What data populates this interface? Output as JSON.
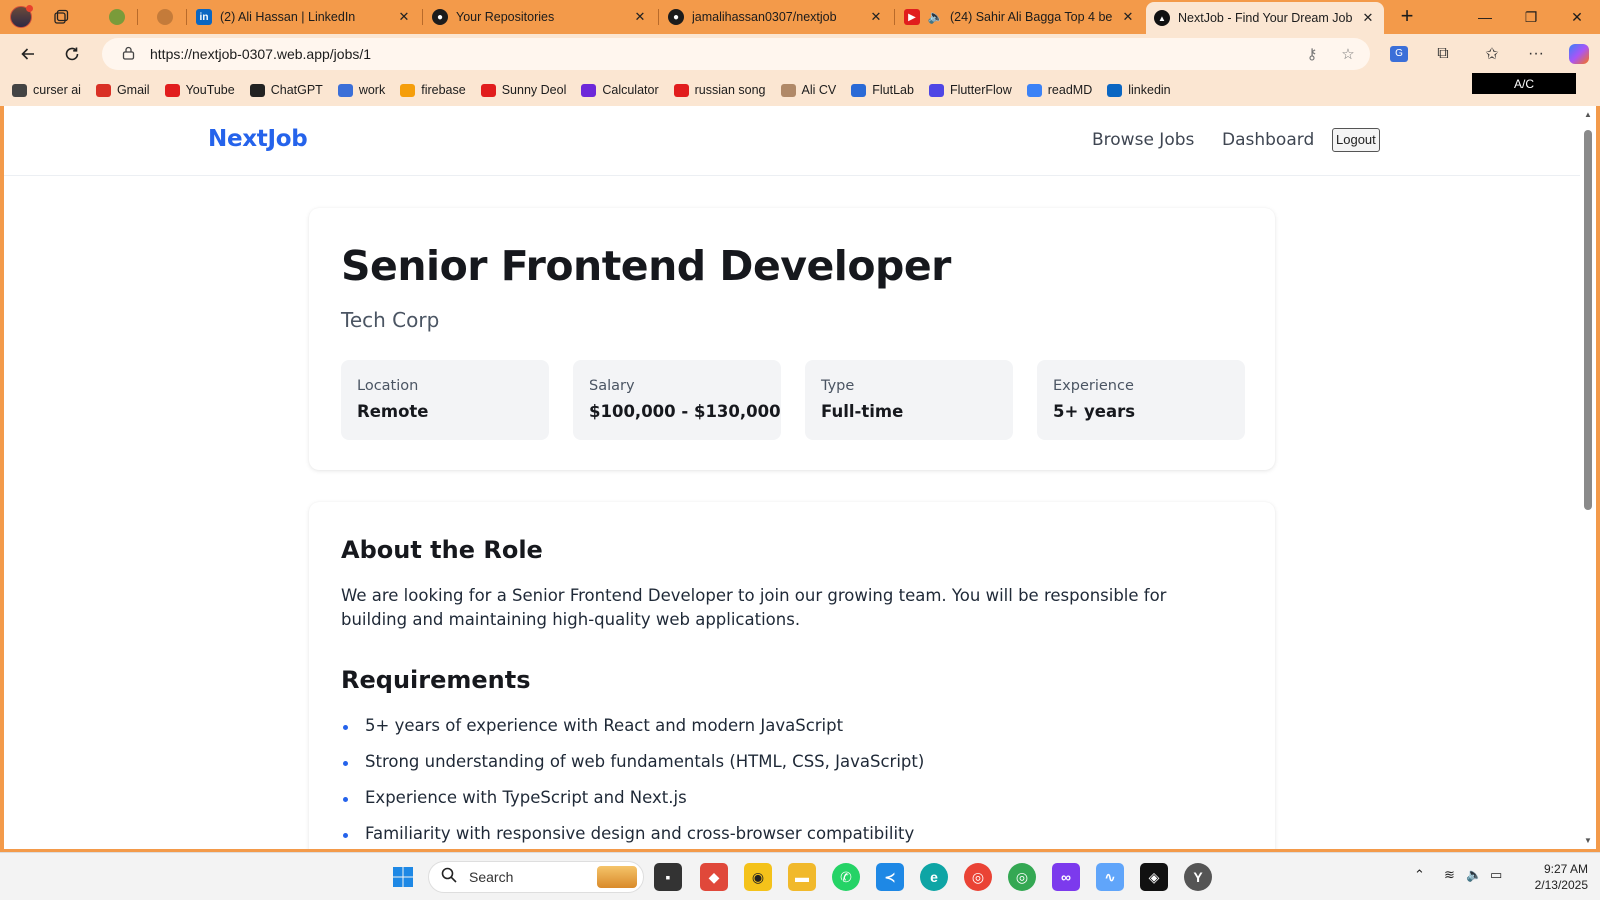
{
  "browser": {
    "tabs": [
      {
        "title": "",
        "favicon": "bundle-icon"
      },
      {
        "title": "",
        "favicon": "green-app-icon"
      },
      {
        "title": "",
        "favicon": "orange-app-icon"
      },
      {
        "title": "(2) Ali Hassan | LinkedIn",
        "favicon": "linkedin-icon"
      },
      {
        "title": "Your Repositories",
        "favicon": "github-icon"
      },
      {
        "title": "jamalihassan0307/nextjob",
        "favicon": "github-icon"
      },
      {
        "title": "(24) Sahir Ali Bagga Top 4 be",
        "favicon": "youtube-icon"
      },
      {
        "title": "NextJob - Find Your Dream Job",
        "favicon": "vercel-icon"
      }
    ],
    "new_tab": "+",
    "url": "https://nextjob-0307.web.app/jobs/1",
    "bookmarks": [
      {
        "label": "curser ai",
        "icon": "cursor-icon",
        "color": "#444444"
      },
      {
        "label": "Gmail",
        "icon": "gmail-icon",
        "color": "#d93025"
      },
      {
        "label": "YouTube",
        "icon": "youtube-icon",
        "color": "#e11d1d"
      },
      {
        "label": "ChatGPT",
        "icon": "chatgpt-icon",
        "color": "#222222"
      },
      {
        "label": "work",
        "icon": "docs-icon",
        "color": "#3b6fd8"
      },
      {
        "label": "firebase",
        "icon": "firebase-icon",
        "color": "#f59e0b"
      },
      {
        "label": "Sunny Deol",
        "icon": "youtube-icon",
        "color": "#e11d1d"
      },
      {
        "label": "Calculator",
        "icon": "calculator-icon",
        "color": "#6d28d9"
      },
      {
        "label": "russian song",
        "icon": "youtube-icon",
        "color": "#e11d1d"
      },
      {
        "label": "Ali CV",
        "icon": "cv-icon",
        "color": "#b08968"
      },
      {
        "label": "FlutLab",
        "icon": "flutlab-icon",
        "color": "#2a6ad6"
      },
      {
        "label": "FlutterFlow",
        "icon": "flutterflow-icon",
        "color": "#4f46e5"
      },
      {
        "label": "readMD",
        "icon": "readmd-icon",
        "color": "#3b82f6"
      },
      {
        "label": "linkedin",
        "icon": "linkedin-icon",
        "color": "#0a66c2"
      }
    ],
    "ac_badge": "A/C"
  },
  "site": {
    "logo": "NextJob",
    "nav": {
      "browse": "Browse Jobs",
      "dashboard": "Dashboard",
      "logout": "Logout"
    },
    "brand_color": "#2563eb"
  },
  "job": {
    "title": "Senior Frontend Developer",
    "company": "Tech Corp",
    "stats": [
      {
        "label": "Location",
        "value": "Remote"
      },
      {
        "label": "Salary",
        "value": "$100,000 - $130,000"
      },
      {
        "label": "Type",
        "value": "Full-time"
      },
      {
        "label": "Experience",
        "value": "5+ years"
      }
    ],
    "about_heading": "About the Role",
    "about_text": "We are looking for a Senior Frontend Developer to join our growing team. You will be responsible for building and maintaining high-quality web applications.",
    "requirements_heading": "Requirements",
    "requirements": [
      "5+ years of experience with React and modern JavaScript",
      "Strong understanding of web fundamentals (HTML, CSS, JavaScript)",
      "Experience with TypeScript and Next.js",
      "Familiarity with responsive design and cross-browser compatibility"
    ]
  },
  "taskbar": {
    "search_placeholder": "Search",
    "time": "9:27 AM",
    "date": "2/13/2025"
  }
}
